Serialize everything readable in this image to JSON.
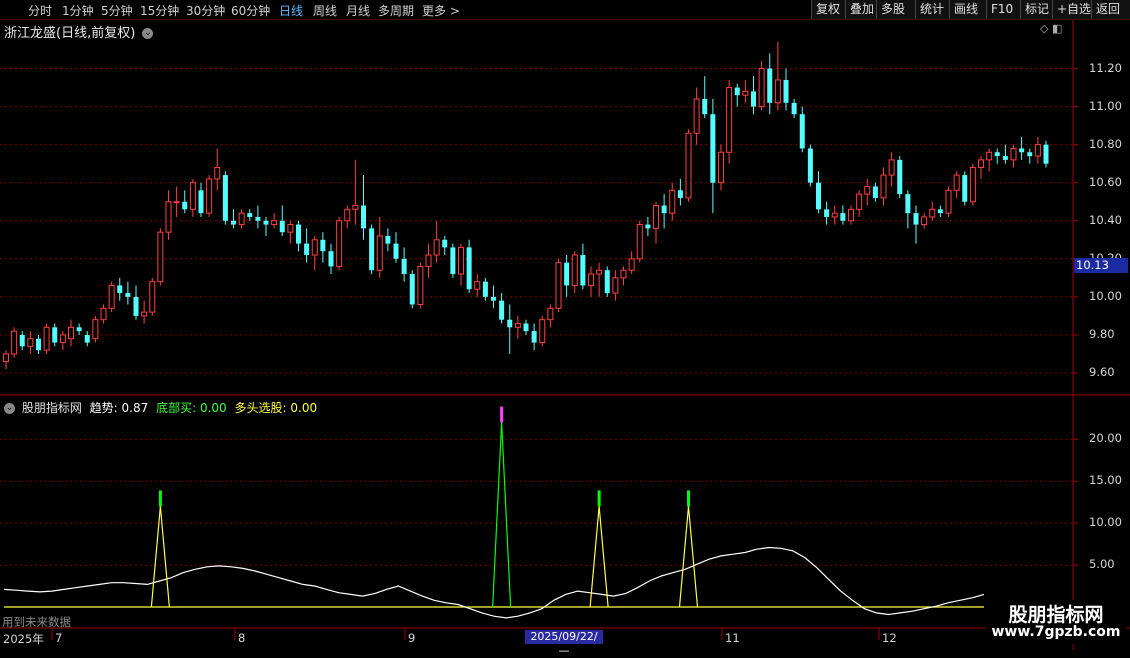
{
  "toolbar": {
    "periods": [
      "分时",
      "1分钟",
      "5分钟",
      "15分钟",
      "30分钟",
      "60分钟",
      "日线",
      "周线",
      "月线",
      "多周期",
      "更多 >"
    ],
    "active_period": "日线",
    "right_buttons": [
      "复权",
      "叠加",
      "多股",
      "统计",
      "画线",
      "F10",
      "标记",
      "+自选",
      "返回"
    ]
  },
  "stock": {
    "title": "浙江龙盛(日线,前复权)",
    "current_price": "10.13"
  },
  "indicator": {
    "name": "股朋指标网",
    "trend_label": "趋势:",
    "trend_value": "0.87",
    "bottom_buy_label": "底部买:",
    "bottom_buy_value": "0.00",
    "bull_pick_label": "多头选股:",
    "bull_pick_value": "0.00"
  },
  "price_axis": [
    "11.20",
    "11.00",
    "10.80",
    "10.60",
    "10.40",
    "10.20",
    "10.00",
    "9.80",
    "9.60"
  ],
  "indicator_axis": [
    "20.00",
    "15.00",
    "10.00",
    "5.00"
  ],
  "date_axis": {
    "labels": [
      "2025年",
      "7",
      "8",
      "9",
      "11",
      "12"
    ],
    "cursor_date": "2025/09/22/—"
  },
  "bottom_note": "用到未来数据",
  "watermark": {
    "title": "股朋指标网",
    "url": "www.7gpzb.com"
  },
  "colors": {
    "up": "#ff4040",
    "down": "#54ffff",
    "grid": "#7a0000",
    "trend_line": "#ffffff",
    "baseline": "#ffff40",
    "bottom_buy": "#00ff00",
    "peak": "#ff40ff"
  },
  "chart_data": {
    "type": "candlestick",
    "price_ylim": [
      9.5,
      11.35
    ],
    "candles_ohlc": [
      [
        9.66,
        9.72,
        9.62,
        9.7
      ],
      [
        9.7,
        9.84,
        9.68,
        9.82
      ],
      [
        9.8,
        9.82,
        9.72,
        9.74
      ],
      [
        9.74,
        9.82,
        9.7,
        9.78
      ],
      [
        9.78,
        9.8,
        9.7,
        9.72
      ],
      [
        9.72,
        9.86,
        9.7,
        9.84
      ],
      [
        9.84,
        9.86,
        9.74,
        9.76
      ],
      [
        9.76,
        9.82,
        9.72,
        9.8
      ],
      [
        9.78,
        9.88,
        9.74,
        9.84
      ],
      [
        9.84,
        9.86,
        9.8,
        9.82
      ],
      [
        9.8,
        9.82,
        9.74,
        9.76
      ],
      [
        9.78,
        9.9,
        9.76,
        9.88
      ],
      [
        9.88,
        9.96,
        9.86,
        9.94
      ],
      [
        9.94,
        10.08,
        9.92,
        10.06
      ],
      [
        10.06,
        10.1,
        9.98,
        10.02
      ],
      [
        10.02,
        10.08,
        9.96,
        10.0
      ],
      [
        10.0,
        10.06,
        9.88,
        9.9
      ],
      [
        9.9,
        9.98,
        9.86,
        9.92
      ],
      [
        9.92,
        10.1,
        9.9,
        10.08
      ],
      [
        10.08,
        10.36,
        10.06,
        10.34
      ],
      [
        10.34,
        10.56,
        10.3,
        10.5
      ],
      [
        10.5,
        10.58,
        10.42,
        10.5
      ],
      [
        10.5,
        10.56,
        10.44,
        10.46
      ],
      [
        10.46,
        10.62,
        10.42,
        10.6
      ],
      [
        10.56,
        10.6,
        10.42,
        10.44
      ],
      [
        10.44,
        10.64,
        10.42,
        10.62
      ],
      [
        10.62,
        10.78,
        10.56,
        10.68
      ],
      [
        10.64,
        10.66,
        10.38,
        10.4
      ],
      [
        10.4,
        10.46,
        10.36,
        10.38
      ],
      [
        10.38,
        10.46,
        10.36,
        10.44
      ],
      [
        10.44,
        10.46,
        10.4,
        10.42
      ],
      [
        10.42,
        10.48,
        10.36,
        10.4
      ],
      [
        10.4,
        10.42,
        10.32,
        10.38
      ],
      [
        10.38,
        10.44,
        10.36,
        10.4
      ],
      [
        10.4,
        10.48,
        10.32,
        10.34
      ],
      [
        10.34,
        10.4,
        10.28,
        10.38
      ],
      [
        10.38,
        10.4,
        10.24,
        10.28
      ],
      [
        10.28,
        10.36,
        10.18,
        10.22
      ],
      [
        10.22,
        10.32,
        10.14,
        10.3
      ],
      [
        10.3,
        10.34,
        10.18,
        10.24
      ],
      [
        10.24,
        10.28,
        10.12,
        10.16
      ],
      [
        10.16,
        10.42,
        10.14,
        10.4
      ],
      [
        10.4,
        10.48,
        10.36,
        10.46
      ],
      [
        10.46,
        10.72,
        10.38,
        10.48
      ],
      [
        10.48,
        10.64,
        10.3,
        10.36
      ],
      [
        10.36,
        10.38,
        10.12,
        10.14
      ],
      [
        10.14,
        10.42,
        10.1,
        10.32
      ],
      [
        10.32,
        10.36,
        10.24,
        10.28
      ],
      [
        10.28,
        10.34,
        10.18,
        10.2
      ],
      [
        10.2,
        10.26,
        10.08,
        10.12
      ],
      [
        10.12,
        10.14,
        9.94,
        9.96
      ],
      [
        9.96,
        10.18,
        9.94,
        10.16
      ],
      [
        10.16,
        10.28,
        10.1,
        10.22
      ],
      [
        10.22,
        10.4,
        10.18,
        10.3
      ],
      [
        10.3,
        10.32,
        10.22,
        10.26
      ],
      [
        10.26,
        10.28,
        10.1,
        10.12
      ],
      [
        10.12,
        10.28,
        10.06,
        10.26
      ],
      [
        10.26,
        10.3,
        10.02,
        10.04
      ],
      [
        10.04,
        10.12,
        10.0,
        10.08
      ],
      [
        10.08,
        10.1,
        9.98,
        10.0
      ],
      [
        10.0,
        10.06,
        9.94,
        9.98
      ],
      [
        9.98,
        10.02,
        9.86,
        9.88
      ],
      [
        9.88,
        9.96,
        9.7,
        9.84
      ],
      [
        9.84,
        9.9,
        9.78,
        9.86
      ],
      [
        9.86,
        9.88,
        9.8,
        9.82
      ],
      [
        9.82,
        9.86,
        9.72,
        9.76
      ],
      [
        9.76,
        9.9,
        9.74,
        9.88
      ],
      [
        9.88,
        9.96,
        9.84,
        9.94
      ],
      [
        9.94,
        10.2,
        9.92,
        10.18
      ],
      [
        10.18,
        10.22,
        10.0,
        10.06
      ],
      [
        10.06,
        10.24,
        10.02,
        10.22
      ],
      [
        10.22,
        10.28,
        10.04,
        10.06
      ],
      [
        10.06,
        10.16,
        10.0,
        10.12
      ],
      [
        10.12,
        10.18,
        10.0,
        10.14
      ],
      [
        10.14,
        10.16,
        10.0,
        10.02
      ],
      [
        10.02,
        10.14,
        9.98,
        10.1
      ],
      [
        10.1,
        10.16,
        10.06,
        10.14
      ],
      [
        10.14,
        10.24,
        10.12,
        10.2
      ],
      [
        10.2,
        10.4,
        10.18,
        10.38
      ],
      [
        10.38,
        10.42,
        10.32,
        10.36
      ],
      [
        10.36,
        10.5,
        10.28,
        10.48
      ],
      [
        10.48,
        10.54,
        10.36,
        10.44
      ],
      [
        10.44,
        10.6,
        10.4,
        10.56
      ],
      [
        10.56,
        10.62,
        10.48,
        10.52
      ],
      [
        10.52,
        10.88,
        10.5,
        10.86
      ],
      [
        10.86,
        11.1,
        10.8,
        11.04
      ],
      [
        11.04,
        11.16,
        10.94,
        10.96
      ],
      [
        10.96,
        11.04,
        10.44,
        10.6
      ],
      [
        10.6,
        10.8,
        10.56,
        10.76
      ],
      [
        10.76,
        11.14,
        10.7,
        11.1
      ],
      [
        11.1,
        11.12,
        11.0,
        11.06
      ],
      [
        11.06,
        11.14,
        11.02,
        11.08
      ],
      [
        11.08,
        11.16,
        10.96,
        11.0
      ],
      [
        11.0,
        11.24,
        10.98,
        11.2
      ],
      [
        11.2,
        11.28,
        10.96,
        11.02
      ],
      [
        11.02,
        11.34,
        10.98,
        11.14
      ],
      [
        11.14,
        11.2,
        10.98,
        11.02
      ],
      [
        11.02,
        11.04,
        10.94,
        10.96
      ],
      [
        10.96,
        11.0,
        10.76,
        10.78
      ],
      [
        10.78,
        10.8,
        10.58,
        10.6
      ],
      [
        10.6,
        10.66,
        10.44,
        10.46
      ],
      [
        10.46,
        10.5,
        10.38,
        10.42
      ],
      [
        10.42,
        10.48,
        10.38,
        10.44
      ],
      [
        10.44,
        10.48,
        10.38,
        10.4
      ],
      [
        10.4,
        10.48,
        10.38,
        10.46
      ],
      [
        10.46,
        10.56,
        10.42,
        10.54
      ],
      [
        10.54,
        10.62,
        10.48,
        10.58
      ],
      [
        10.58,
        10.6,
        10.5,
        10.52
      ],
      [
        10.52,
        10.68,
        10.48,
        10.64
      ],
      [
        10.64,
        10.76,
        10.58,
        10.72
      ],
      [
        10.72,
        10.74,
        10.52,
        10.54
      ],
      [
        10.54,
        10.56,
        10.36,
        10.44
      ],
      [
        10.44,
        10.48,
        10.28,
        10.38
      ],
      [
        10.38,
        10.44,
        10.36,
        10.42
      ],
      [
        10.42,
        10.5,
        10.4,
        10.46
      ],
      [
        10.46,
        10.48,
        10.42,
        10.44
      ],
      [
        10.44,
        10.58,
        10.42,
        10.56
      ],
      [
        10.56,
        10.66,
        10.52,
        10.64
      ],
      [
        10.64,
        10.66,
        10.48,
        10.5
      ],
      [
        10.5,
        10.7,
        10.48,
        10.68
      ],
      [
        10.68,
        10.74,
        10.62,
        10.72
      ],
      [
        10.72,
        10.78,
        10.66,
        10.76
      ],
      [
        10.76,
        10.78,
        10.7,
        10.74
      ],
      [
        10.74,
        10.8,
        10.7,
        10.72
      ],
      [
        10.72,
        10.8,
        10.68,
        10.78
      ],
      [
        10.78,
        10.84,
        10.72,
        10.76
      ],
      [
        10.76,
        10.78,
        10.7,
        10.74
      ],
      [
        10.74,
        10.84,
        10.7,
        10.8
      ],
      [
        10.8,
        10.82,
        10.68,
        10.7
      ]
    ],
    "trend_line": [
      1.8,
      1.7,
      1.6,
      1.5,
      1.6,
      1.8,
      2.0,
      2.2,
      2.4,
      2.6,
      2.6,
      2.5,
      2.4,
      2.8,
      3.2,
      3.8,
      4.2,
      4.5,
      4.6,
      4.5,
      4.3,
      4.0,
      3.6,
      3.2,
      2.8,
      2.4,
      2.2,
      1.8,
      1.4,
      1.2,
      1.0,
      1.3,
      1.8,
      2.2,
      1.6,
      1.0,
      0.5,
      0.2,
      0.0,
      -0.5,
      -1.0,
      -1.4,
      -1.6,
      -1.4,
      -1.0,
      -0.5,
      0.5,
      1.2,
      1.6,
      1.4,
      1.2,
      1.0,
      1.3,
      2.0,
      2.8,
      3.4,
      3.8,
      4.2,
      4.8,
      5.4,
      5.8,
      6.0,
      6.2,
      6.6,
      6.8,
      6.7,
      6.4,
      5.6,
      4.4,
      3.0,
      1.6,
      0.5,
      -0.5,
      -1.0,
      -1.2,
      -1.0,
      -0.8,
      -0.5,
      -0.2,
      0.2,
      0.5,
      0.8,
      1.2
    ],
    "bottom_buy_signals": [
      {
        "index": 19,
        "value": 12
      },
      {
        "index": 73,
        "value": 12
      },
      {
        "index": 84,
        "value": 12
      }
    ],
    "trend_peak_signal": {
      "index": 61,
      "value": 22
    }
  }
}
